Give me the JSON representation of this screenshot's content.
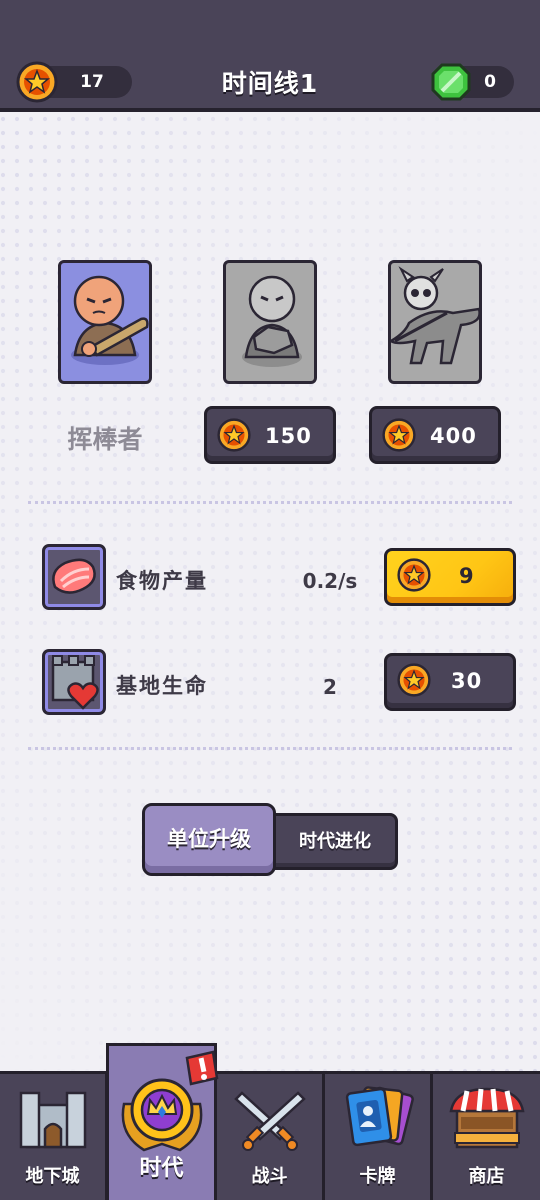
{
  "header": {
    "title": "时间线1",
    "coins": "17",
    "gems": "0"
  },
  "units": [
    {
      "name": "挥棒者",
      "icon": "caveman-club-icon",
      "unlocked": true
    },
    {
      "price": "150",
      "icon": "rock-thrower-icon",
      "unlocked": false
    },
    {
      "price": "400",
      "icon": "dino-rider-icon",
      "unlocked": false
    }
  ],
  "stats": [
    {
      "label": "食物产量",
      "value": "0.2/s",
      "cost": "9",
      "icon": "meat-icon"
    },
    {
      "label": "基地生命",
      "value": "2",
      "cost": "30",
      "icon": "castle-heart-icon"
    }
  ],
  "tabs": {
    "active": "单位升级",
    "inactive": "时代进化"
  },
  "nav": [
    {
      "label": "地下城",
      "icon": "castle-icon"
    },
    {
      "label": "时代",
      "icon": "crown-emblem-icon",
      "active": true
    },
    {
      "label": "战斗",
      "icon": "crossed-swords-icon"
    },
    {
      "label": "卡牌",
      "icon": "cards-icon"
    },
    {
      "label": "商店",
      "icon": "shop-stall-icon"
    }
  ],
  "colors": {
    "panel": "#4a4458",
    "accent": "#9a8dc3",
    "gold": "#ffc615"
  }
}
